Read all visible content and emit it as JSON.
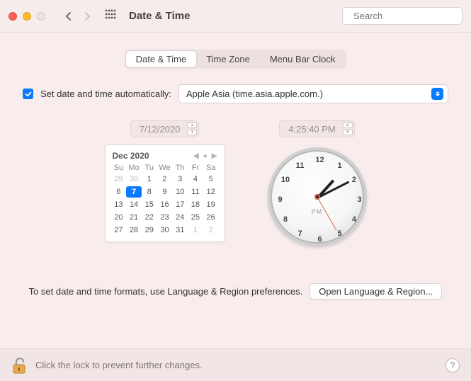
{
  "header": {
    "title": "Date & Time",
    "search_placeholder": "Search"
  },
  "tabs": [
    {
      "label": "Date & Time",
      "active": true
    },
    {
      "label": "Time Zone",
      "active": false
    },
    {
      "label": "Menu Bar Clock",
      "active": false
    }
  ],
  "auto": {
    "checked": true,
    "label": "Set date and time automatically:",
    "server": "Apple Asia (time.asia.apple.com.)"
  },
  "date": {
    "value": "7/12/2020"
  },
  "time": {
    "value": "4:25:40 PM",
    "ampm": "PM",
    "hour_angle": 42,
    "minute_angle": 63,
    "second_angle": 150
  },
  "calendar": {
    "title": "Dec 2020",
    "dow": [
      "Su",
      "Mo",
      "Tu",
      "We",
      "Th",
      "Fr",
      "Sa"
    ],
    "days": [
      {
        "n": "29",
        "other": true
      },
      {
        "n": "30",
        "other": true
      },
      {
        "n": "1"
      },
      {
        "n": "2"
      },
      {
        "n": "3"
      },
      {
        "n": "4"
      },
      {
        "n": "5"
      },
      {
        "n": "6"
      },
      {
        "n": "7",
        "selected": true
      },
      {
        "n": "8"
      },
      {
        "n": "9"
      },
      {
        "n": "10"
      },
      {
        "n": "11"
      },
      {
        "n": "12"
      },
      {
        "n": "13"
      },
      {
        "n": "14"
      },
      {
        "n": "15"
      },
      {
        "n": "16"
      },
      {
        "n": "17"
      },
      {
        "n": "18"
      },
      {
        "n": "19"
      },
      {
        "n": "20"
      },
      {
        "n": "21"
      },
      {
        "n": "22"
      },
      {
        "n": "23"
      },
      {
        "n": "24"
      },
      {
        "n": "25"
      },
      {
        "n": "26"
      },
      {
        "n": "27"
      },
      {
        "n": "28"
      },
      {
        "n": "29"
      },
      {
        "n": "30"
      },
      {
        "n": "31"
      },
      {
        "n": "1",
        "other": true
      },
      {
        "n": "2",
        "other": true
      }
    ]
  },
  "clock_numbers": [
    "12",
    "1",
    "2",
    "3",
    "4",
    "5",
    "6",
    "7",
    "8",
    "9",
    "10",
    "11"
  ],
  "format_row": {
    "text": "To set date and time formats, use Language & Region preferences.",
    "button": "Open Language & Region..."
  },
  "bottom": {
    "text": "Click the lock to prevent further changes.",
    "help": "?"
  }
}
